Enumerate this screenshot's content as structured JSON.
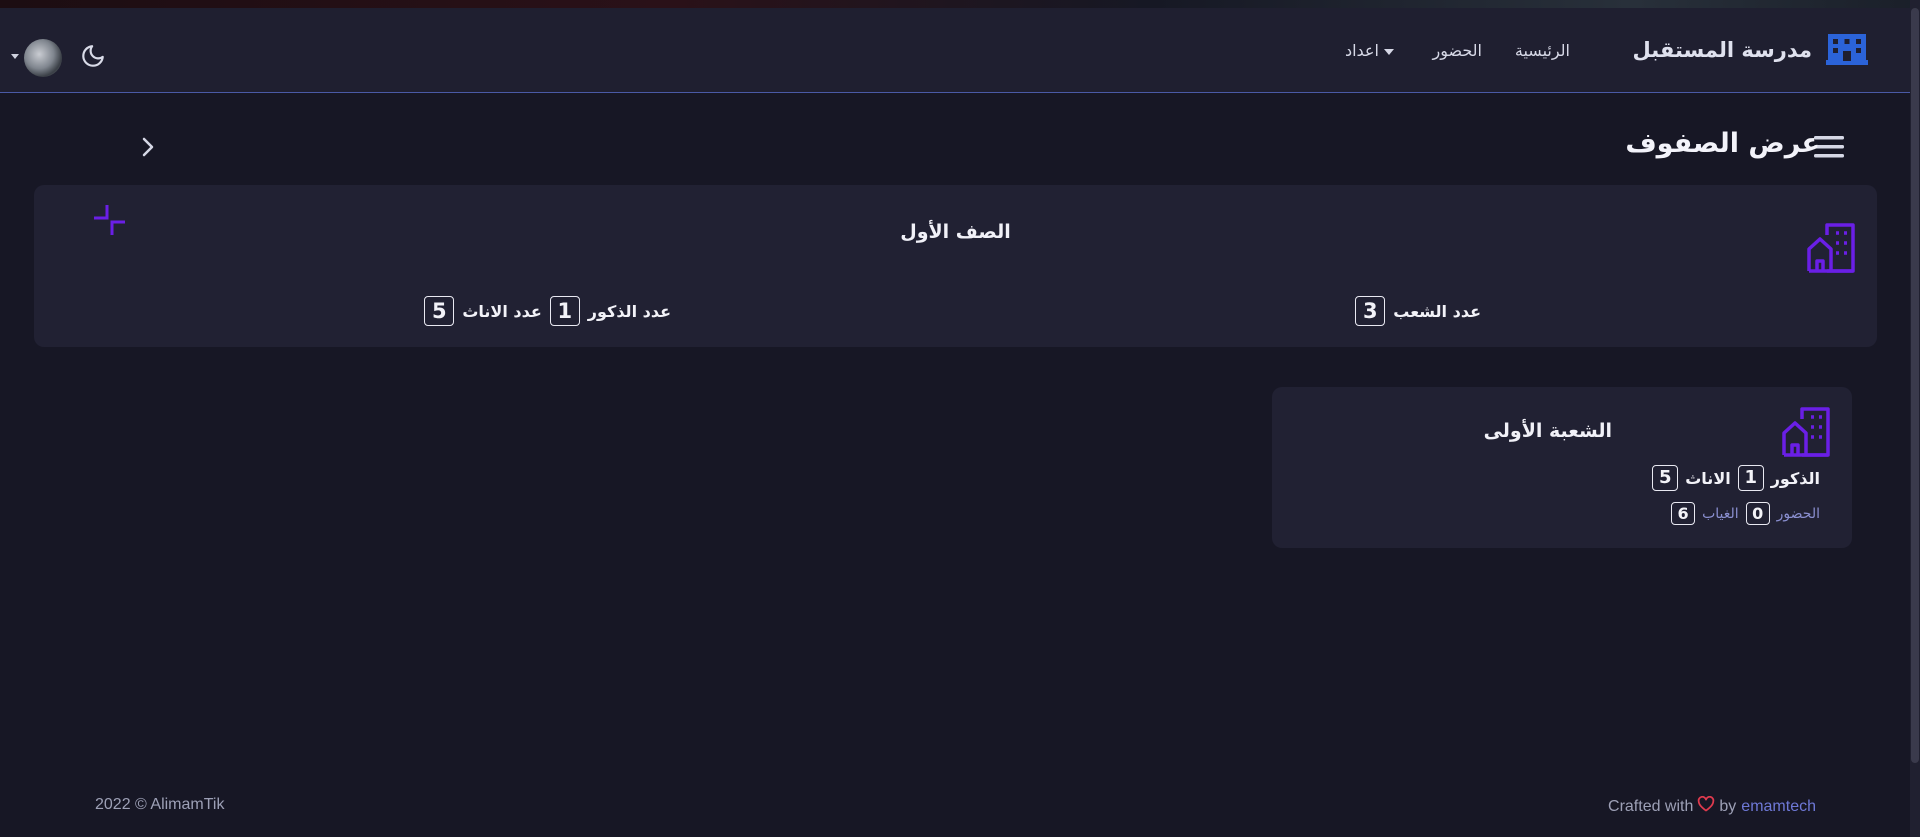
{
  "navbar": {
    "brand": "مدرسة المستقبل",
    "items": [
      {
        "label": "الرئيسية"
      },
      {
        "label": "الحضور"
      },
      {
        "label": "اعداد"
      }
    ]
  },
  "page": {
    "title": "عرض الصفوف"
  },
  "grade_card": {
    "title": "الصف الأول",
    "sections_label": "عدد الشعب",
    "sections_count": "3",
    "males_label": "عدد الذكور",
    "males_count": "1",
    "females_label": "عدد الاناث",
    "females_count": "5"
  },
  "section_card": {
    "title": "الشعبة الأولى",
    "males_label": "الذكور",
    "males_count": "1",
    "females_label": "الاناث",
    "females_count": "5",
    "present_label": "الحضور",
    "present_count": "0",
    "absent_label": "الغياب",
    "absent_count": "6"
  },
  "footer": {
    "copyright": "2022 © AlimamTik",
    "crafted": "Crafted with",
    "by": "by",
    "author": "emamtech"
  },
  "colors": {
    "accent": "#6a1fe6",
    "brand_icon": "#2b63d8",
    "heart": "#e03a4e",
    "link": "#6e78d6"
  }
}
